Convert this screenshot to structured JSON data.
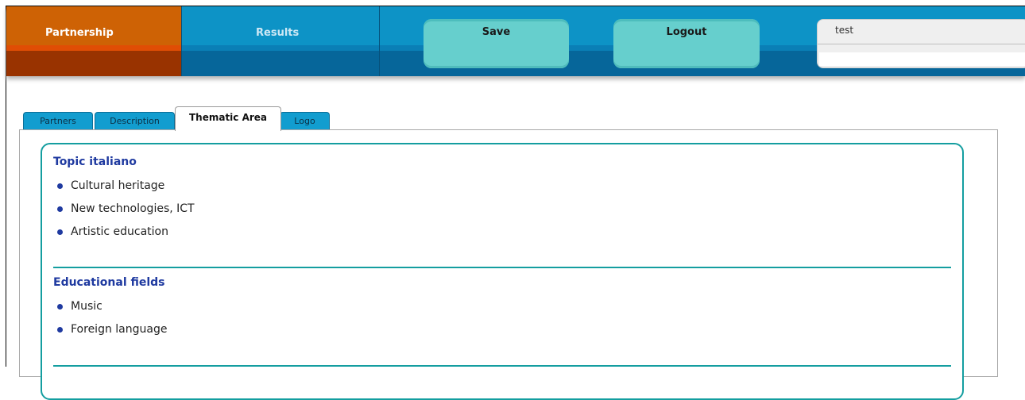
{
  "header": {
    "nav_partnership": "Partnership",
    "nav_results": "Results",
    "save_label": "Save",
    "logout_label": "Logout",
    "user_name": "test"
  },
  "tabs": [
    {
      "label": "Partners",
      "active": false
    },
    {
      "label": "Description",
      "active": false
    },
    {
      "label": "Thematic Area",
      "active": true
    },
    {
      "label": "Logo",
      "active": false
    }
  ],
  "sections": [
    {
      "title": "Topic italiano",
      "items": [
        "Cultural heritage",
        "New technologies, ICT",
        "Artistic education"
      ]
    },
    {
      "title": "Educational fields",
      "items": [
        "Music",
        "Foreign language"
      ]
    }
  ],
  "colors": {
    "accent_teal": "#149ea0",
    "title_blue": "#1f3aa0",
    "nav_orange": "#ce6205",
    "nav_blue": "#0d93c6"
  }
}
